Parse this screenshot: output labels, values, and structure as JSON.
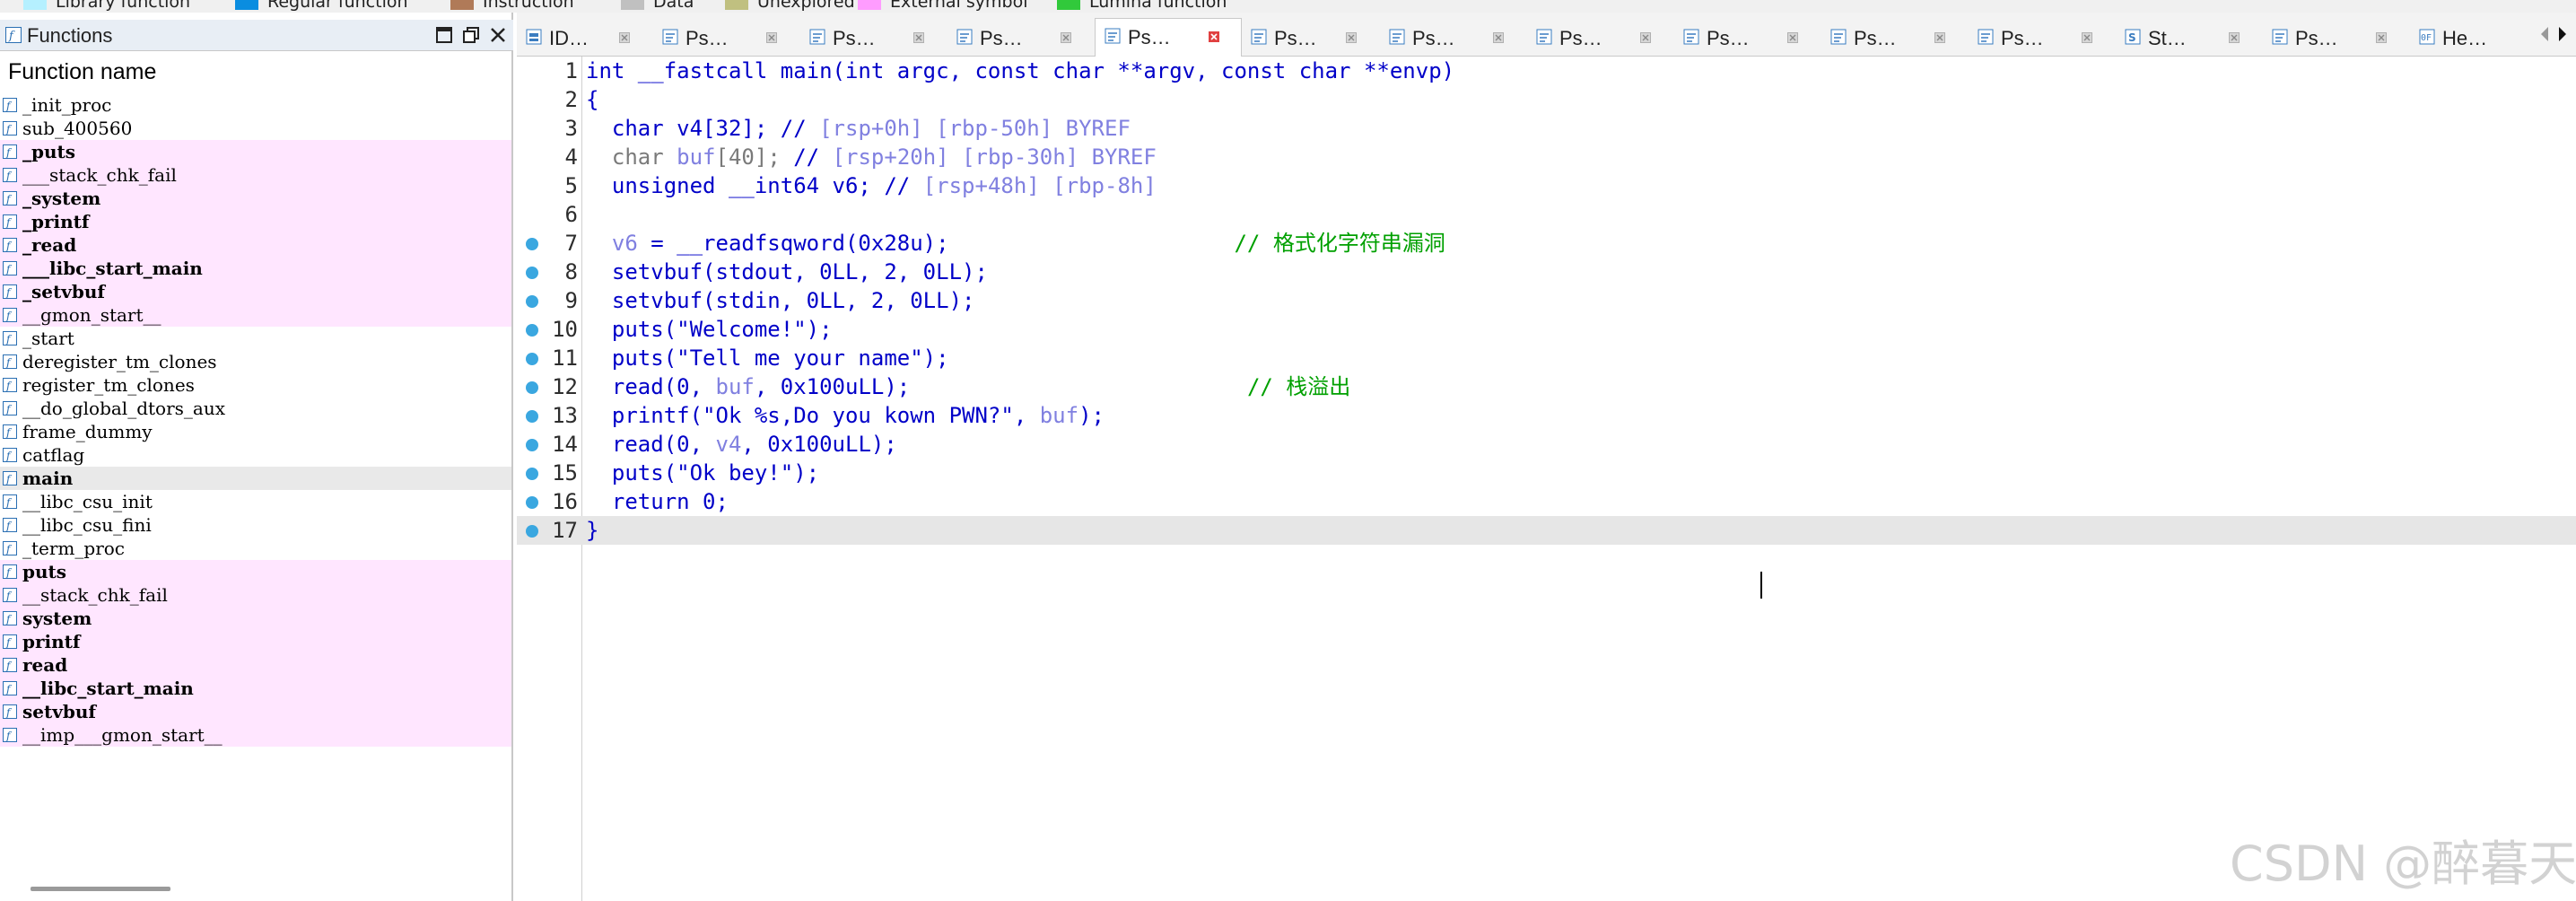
{
  "legend": [
    {
      "label": "Library function",
      "color": "#b5f0ff"
    },
    {
      "label": "Regular function",
      "color": "#0a8de0"
    },
    {
      "label": "Instruction",
      "color": "#b07a58"
    },
    {
      "label": "Data",
      "color": "#c0c0c0"
    },
    {
      "label": "Unexplored",
      "color": "#c0c080"
    },
    {
      "label": "External symbol",
      "color": "#ff9cff"
    },
    {
      "label": "Lumina function",
      "color": "#31c93b"
    }
  ],
  "functions_panel": {
    "title": "Functions",
    "column_header": "Function name",
    "items": [
      {
        "name": "_init_proc",
        "bold": false,
        "bg": "none"
      },
      {
        "name": "sub_400560",
        "bold": false,
        "bg": "none"
      },
      {
        "name": "_puts",
        "bold": true,
        "bg": "pink"
      },
      {
        "name": "___stack_chk_fail",
        "bold": false,
        "bg": "pink"
      },
      {
        "name": "_system",
        "bold": true,
        "bg": "pink"
      },
      {
        "name": "_printf",
        "bold": true,
        "bg": "pink"
      },
      {
        "name": "_read",
        "bold": true,
        "bg": "pink"
      },
      {
        "name": "___libc_start_main",
        "bold": true,
        "bg": "pink"
      },
      {
        "name": "_setvbuf",
        "bold": true,
        "bg": "pink"
      },
      {
        "name": "__gmon_start__",
        "bold": false,
        "bg": "pink"
      },
      {
        "name": "_start",
        "bold": false,
        "bg": "none"
      },
      {
        "name": "deregister_tm_clones",
        "bold": false,
        "bg": "none"
      },
      {
        "name": "register_tm_clones",
        "bold": false,
        "bg": "none"
      },
      {
        "name": "__do_global_dtors_aux",
        "bold": false,
        "bg": "none"
      },
      {
        "name": "frame_dummy",
        "bold": false,
        "bg": "none"
      },
      {
        "name": "catflag",
        "bold": false,
        "bg": "none"
      },
      {
        "name": "main",
        "bold": true,
        "bg": "selected"
      },
      {
        "name": "__libc_csu_init",
        "bold": false,
        "bg": "none"
      },
      {
        "name": "__libc_csu_fini",
        "bold": false,
        "bg": "none"
      },
      {
        "name": "_term_proc",
        "bold": false,
        "bg": "none"
      },
      {
        "name": "puts",
        "bold": true,
        "bg": "pink"
      },
      {
        "name": "__stack_chk_fail",
        "bold": false,
        "bg": "pink"
      },
      {
        "name": "system",
        "bold": true,
        "bg": "pink"
      },
      {
        "name": "printf",
        "bold": true,
        "bg": "pink"
      },
      {
        "name": "read",
        "bold": true,
        "bg": "pink"
      },
      {
        "name": "__libc_start_main",
        "bold": true,
        "bg": "pink"
      },
      {
        "name": "setvbuf",
        "bold": true,
        "bg": "pink"
      },
      {
        "name": "__imp___gmon_start__",
        "bold": false,
        "bg": "pink"
      }
    ]
  },
  "tabs": [
    {
      "label": "ID…",
      "icon": "ida-view-icon",
      "active": false
    },
    {
      "label": "Ps…",
      "icon": "pseudocode-icon",
      "active": false
    },
    {
      "label": "Ps…",
      "icon": "pseudocode-icon",
      "active": false
    },
    {
      "label": "Ps…",
      "icon": "pseudocode-icon",
      "active": false
    },
    {
      "label": "Ps…",
      "icon": "pseudocode-icon",
      "active": true
    },
    {
      "label": "Ps…",
      "icon": "pseudocode-icon",
      "active": false
    },
    {
      "label": "Ps…",
      "icon": "pseudocode-icon",
      "active": false
    },
    {
      "label": "Ps…",
      "icon": "pseudocode-icon",
      "active": false
    },
    {
      "label": "Ps…",
      "icon": "pseudocode-icon",
      "active": false
    },
    {
      "label": "Ps…",
      "icon": "pseudocode-icon",
      "active": false
    },
    {
      "label": "Ps…",
      "icon": "pseudocode-icon",
      "active": false
    },
    {
      "label": "St…",
      "icon": "strings-icon",
      "active": false
    },
    {
      "label": "Ps…",
      "icon": "pseudocode-icon",
      "active": false
    },
    {
      "label": "He…",
      "icon": "hex-view-icon",
      "active": false
    }
  ],
  "code": [
    {
      "num": "1",
      "bp": false,
      "tokens": [
        [
          "k",
          "int __fastcall main(int argc, const char **argv, const char **envp)"
        ]
      ]
    },
    {
      "num": "2",
      "bp": false,
      "tokens": [
        [
          "k",
          "{"
        ]
      ]
    },
    {
      "num": "3",
      "bp": false,
      "tokens": [
        [
          "k",
          "  char v4[32]; "
        ],
        [
          "cm",
          "// "
        ],
        [
          "g",
          "[rsp+0h] [rbp-50h] BYREF"
        ]
      ]
    },
    {
      "num": "4",
      "bp": false,
      "tokens": [
        [
          "gr",
          "  char "
        ],
        [
          "vv",
          "buf"
        ],
        [
          "gr",
          "[40]; "
        ],
        [
          "cm",
          "// "
        ],
        [
          "g",
          "[rsp+20h] [rbp-30h] BYREF"
        ]
      ]
    },
    {
      "num": "5",
      "bp": false,
      "tokens": [
        [
          "k",
          "  unsigned __int64 v6; "
        ],
        [
          "cm",
          "// "
        ],
        [
          "g",
          "[rsp+48h] [rbp-8h]"
        ]
      ]
    },
    {
      "num": "6",
      "bp": false,
      "tokens": [
        [
          "k",
          ""
        ]
      ]
    },
    {
      "num": "7",
      "bp": true,
      "tokens": [
        [
          "vv",
          "  v6"
        ],
        [
          "k",
          " = __readfsqword(0x28u);                      "
        ],
        [
          "cz",
          "// 格式化字符串漏洞"
        ]
      ]
    },
    {
      "num": "8",
      "bp": true,
      "tokens": [
        [
          "k",
          "  setvbuf(stdout, 0LL, 2, 0LL);"
        ]
      ]
    },
    {
      "num": "9",
      "bp": true,
      "tokens": [
        [
          "k",
          "  setvbuf(stdin, 0LL, 2, 0LL);"
        ]
      ]
    },
    {
      "num": "10",
      "bp": true,
      "tokens": [
        [
          "k",
          "  puts(\"Welcome!\");"
        ]
      ]
    },
    {
      "num": "11",
      "bp": true,
      "tokens": [
        [
          "k",
          "  puts(\"Tell me your name\");"
        ]
      ]
    },
    {
      "num": "12",
      "bp": true,
      "tokens": [
        [
          "k",
          "  read(0, "
        ],
        [
          "vv",
          "buf"
        ],
        [
          "k",
          ", 0x100uLL);                          "
        ],
        [
          "cz",
          "// 栈溢出"
        ]
      ]
    },
    {
      "num": "13",
      "bp": true,
      "tokens": [
        [
          "k",
          "  printf(\"Ok %s,Do you kown PWN?\", "
        ],
        [
          "vv",
          "buf"
        ],
        [
          "k",
          ");"
        ]
      ]
    },
    {
      "num": "14",
      "bp": true,
      "tokens": [
        [
          "k",
          "  read(0, "
        ],
        [
          "vv",
          "v4"
        ],
        [
          "k",
          ", 0x100uLL);"
        ]
      ]
    },
    {
      "num": "15",
      "bp": true,
      "tokens": [
        [
          "k",
          "  puts(\"Ok bey!\");"
        ]
      ]
    },
    {
      "num": "16",
      "bp": true,
      "tokens": [
        [
          "k",
          "  return 0;"
        ]
      ]
    },
    {
      "num": "17",
      "bp": true,
      "tokens": [
        [
          "k",
          "}"
        ]
      ]
    }
  ],
  "watermark": "CSDN @醉暮天"
}
